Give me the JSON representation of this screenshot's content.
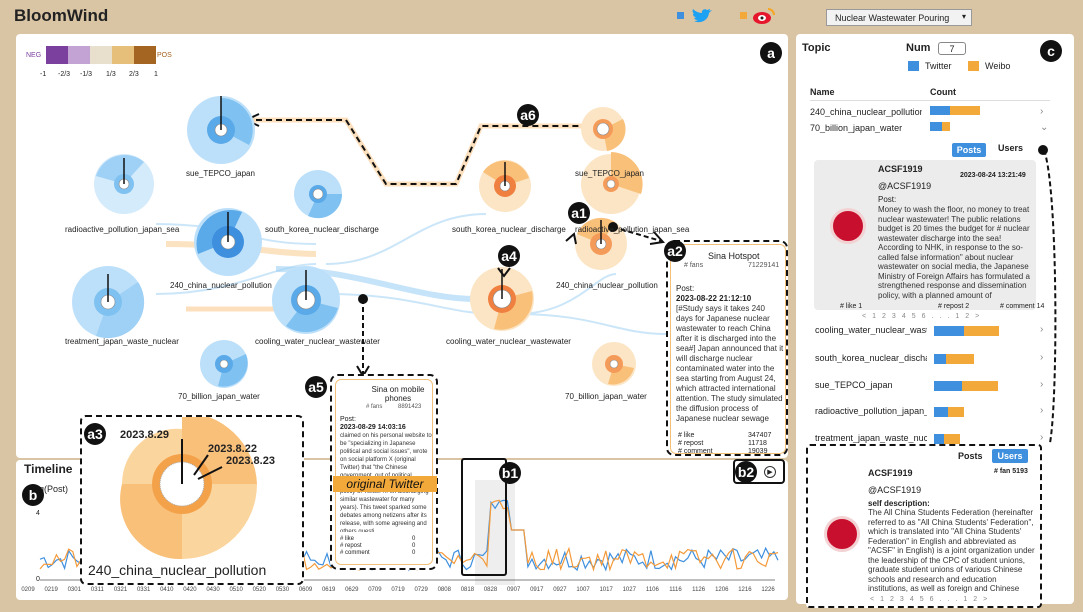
{
  "app": {
    "title": "BloomWind",
    "dropdown": "Nuclear Wastewater Pouring"
  },
  "colors": {
    "twitter": "#3e8fde",
    "weibo": "#f3a93a",
    "bg": "#d9c4a3"
  },
  "legend": {
    "neg": "NEG",
    "pos": "POS",
    "ticks": [
      "-1",
      "-2/3",
      "-1/3",
      "1/3",
      "2/3",
      "1"
    ]
  },
  "tags": {
    "a": "a",
    "b": "b",
    "c": "c",
    "a1": "a1",
    "a2": "a2",
    "a3": "a3",
    "a4": "a4",
    "a5": "a5",
    "a6": "a6",
    "b1": "b1",
    "b2": "b2"
  },
  "left_topics": [
    "sue_TEPCO_japan",
    "radioactive_pollution_japan_sea",
    "south_korea_nuclear_discharge",
    "240_china_nuclear_pollution",
    "treatment_japan_waste_nuclear",
    "cooling_water_nuclear_wastewater",
    "70_billion_japan_water"
  ],
  "right_topics": [
    "sue_TEPCO_japan",
    "south_korea_nuclear_discharge",
    "radioactive_pollution_japan_sea",
    "240_china_nuclear_pollution",
    "cooling_water_nuclear_wastewater",
    "70_billion_japan_water"
  ],
  "zoom": {
    "title": "240_china_nuclear_pollution",
    "dates": [
      "2023.8.29",
      "2023.8.22",
      "2023.8.23"
    ]
  },
  "sina_card": {
    "title": "Sina Hotspot",
    "fans_label": "# fans",
    "fans": "71229141",
    "post_label": "Post:",
    "time": "2023-08-22 21:12:10",
    "text": "[#Study says it takes 240 days for Japanese nuclear wastewater to reach China after it is discharged into the sea#] Japan announced that it will discharge nuclear contaminated water into the sea starting from August 24, which attracted international attention. The study simulated the diffusion process of Japanese nuclear sewage discharged into the sea: it reaches the coast of China in 240 days and covers the North Pacific after 1,200 days. (Jiaodian video) http://t.cn/A6Ozlivu",
    "stats": [
      [
        "# like",
        "347407"
      ],
      [
        "# repost",
        "11718"
      ],
      [
        "# comment",
        "19039"
      ]
    ]
  },
  "mobile_card": {
    "title": "Sina on mobile phones",
    "fans_label": "# fans",
    "fans": "8891423",
    "post_label": "Post:",
    "time": "2023-08-29 14:03:16",
    "text": "claimed on his personal website to be \"specializing in Japanese political and social issues\", wrote on social platform X (original Twitter) that \"the Chinese government, out of political motivation, implemented the policy of Twitter ... en discharging similar wastewater for many years). This tweet sparked some debates among netizens after its release, with some agreeing and others questi",
    "badge": "original Twitter",
    "stats": [
      [
        "# like",
        "0"
      ],
      [
        "# repost",
        "0"
      ],
      [
        "# comment",
        "0"
      ]
    ]
  },
  "timeline": {
    "title": "Timeline",
    "ylabel": "log(Post)",
    "ticks": [
      "0209",
      "0219",
      "0301",
      "0311",
      "0321",
      "0331",
      "0410",
      "0420",
      "0430",
      "0510",
      "0520",
      "0530",
      "0609",
      "0619",
      "0629",
      "0709",
      "0719",
      "0729",
      "0808",
      "0818",
      "0828",
      "0907",
      "0917",
      "0927",
      "1007",
      "1017",
      "1027",
      "1106",
      "1116",
      "1126",
      "1206",
      "1216",
      "1226"
    ],
    "ymarks": [
      "4",
      "0"
    ]
  },
  "topic": {
    "title": "Topic",
    "num_label": "Num",
    "num_value": "7",
    "legend_twitter": "Twitter",
    "legend_weibo": "Weibo",
    "col_name": "Name",
    "col_count": "Count",
    "rows": [
      {
        "name": "240_china_nuclear_pollution",
        "tw": 20,
        "wb": 30
      },
      {
        "name": "70_billion_japan_water",
        "tw": 12,
        "wb": 8
      },
      {
        "name": "cooling_water_nuclear_wastewater",
        "tw": 30,
        "wb": 35
      },
      {
        "name": "south_korea_nuclear_discharge",
        "tw": 12,
        "wb": 28
      },
      {
        "name": "sue_TEPCO_japan",
        "tw": 28,
        "wb": 36
      },
      {
        "name": "radioactive_pollution_japan_sea",
        "tw": 14,
        "wb": 16
      },
      {
        "name": "treatment_japan_waste_nuclear",
        "tw": 10,
        "wb": 16
      }
    ],
    "tabs": {
      "posts": "Posts",
      "users": "Users"
    }
  },
  "post_card": {
    "user": "ACSF1919",
    "handle": "@ACSF1919",
    "time": "2023-08-24 13:21:49",
    "post_label": "Post:",
    "text": "Money to wash the floor, no money to treat nuclear wastewater! The public relations budget is 20 times the budget for # nuclear wastewater discharge into the sea! According to NHK, in response to the so-called false information\" about nuclear wastewater on social media, the Japanese Ministry of Foreign Affairs has formulated a strengthened response and dissemination policy, with a planned amount of approximately 70 billion yen. Almost 20 times the budget",
    "like": "# like 1",
    "repost": "# repost 2",
    "comment": "# comment 14"
  },
  "user_card": {
    "user": "ACSF1919",
    "handle": "@ACSF1919",
    "fans": "# fan 5193",
    "desc_label": "self description:",
    "text": "The All China Students Federation (hereinafter referred to as \"All China Students' Federation\", which is translated into \"All China Students' Federation\" in English and abbreviated as \"ACSF\" in English) is a joint organization under the leadership of the CPC of student unions, graduate student unions of various Chinese schools and research and education institutions, as well as foreign and Chinese student groups."
  },
  "pager": [
    "<",
    "1",
    "2",
    "3",
    "4",
    "5",
    "6",
    "...",
    "12",
    ">"
  ]
}
